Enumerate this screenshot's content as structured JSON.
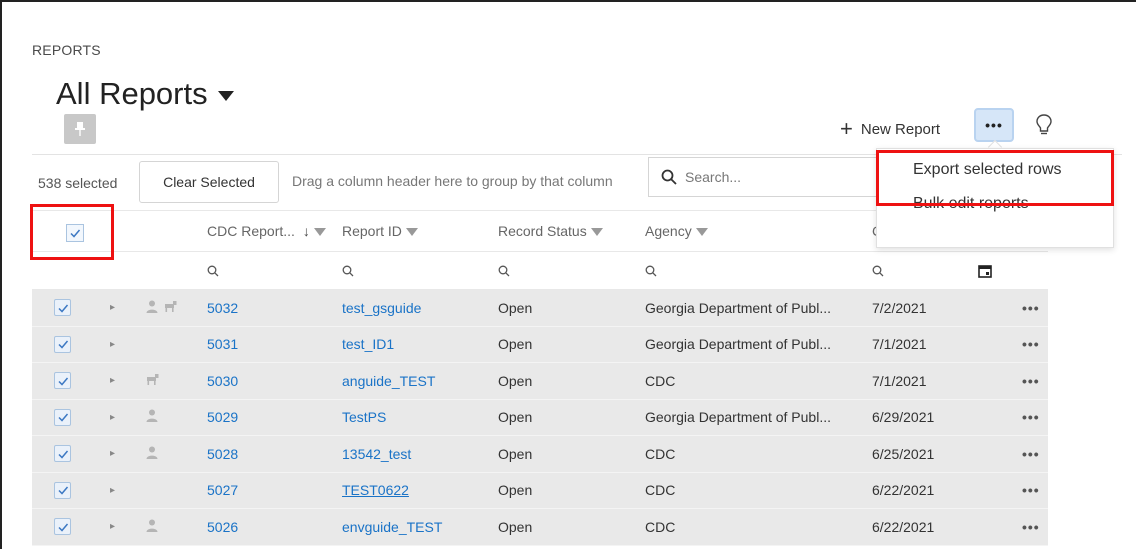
{
  "section_label": "REPORTS",
  "page_title": "All Reports",
  "header_actions": {
    "new_report_label": "New Report",
    "more_label": "•••"
  },
  "toolbar": {
    "selected_count": "538 selected",
    "clear_selected_label": "Clear Selected",
    "group_hint": "Drag a column header here to group by that column",
    "search_placeholder": "Search..."
  },
  "dropdown_menu": {
    "items": [
      "Export selected rows",
      "Bulk edit reports"
    ]
  },
  "columns": {
    "cdc_report": "CDC Report...",
    "report_id": "Report ID",
    "record_status": "Record Status",
    "agency": "Agency",
    "date_partial": "C"
  },
  "rows": [
    {
      "cdc_id": "5032",
      "report_id": "test_gsguide",
      "status": "Open",
      "agency": "Georgia Department of Publ...",
      "date": "7/2/2021",
      "icons": [
        "person-icon",
        "animal-icon"
      ],
      "more": "•••"
    },
    {
      "cdc_id": "5031",
      "report_id": "test_ID1",
      "status": "Open",
      "agency": "Georgia Department of Publ...",
      "date": "7/1/2021",
      "icons": [],
      "more": "•••"
    },
    {
      "cdc_id": "5030",
      "report_id": "anguide_TEST",
      "status": "Open",
      "agency": "CDC",
      "date": "7/1/2021",
      "icons": [
        "animal-icon"
      ],
      "more": "•••"
    },
    {
      "cdc_id": "5029",
      "report_id": "TestPS",
      "status": "Open",
      "agency": "Georgia Department of Publ...",
      "date": "6/29/2021",
      "icons": [
        "person-icon"
      ],
      "more": "•••"
    },
    {
      "cdc_id": "5028",
      "report_id": "13542_test",
      "status": "Open",
      "agency": "CDC",
      "date": "6/25/2021",
      "icons": [
        "person-icon"
      ],
      "more": "•••"
    },
    {
      "cdc_id": "5027",
      "report_id": "TEST0622",
      "status": "Open",
      "agency": "CDC",
      "date": "6/22/2021",
      "icons": [],
      "more": "•••"
    },
    {
      "cdc_id": "5026",
      "report_id": "envguide_TEST",
      "status": "Open",
      "agency": "CDC",
      "date": "6/22/2021",
      "icons": [
        "person-icon"
      ],
      "more": "•••"
    }
  ],
  "colors": {
    "link": "#1a73c7",
    "highlight_outline": "#ee1111",
    "row_bg": "#e9e9e9",
    "more_btn_bg": "#d6e6f8"
  }
}
